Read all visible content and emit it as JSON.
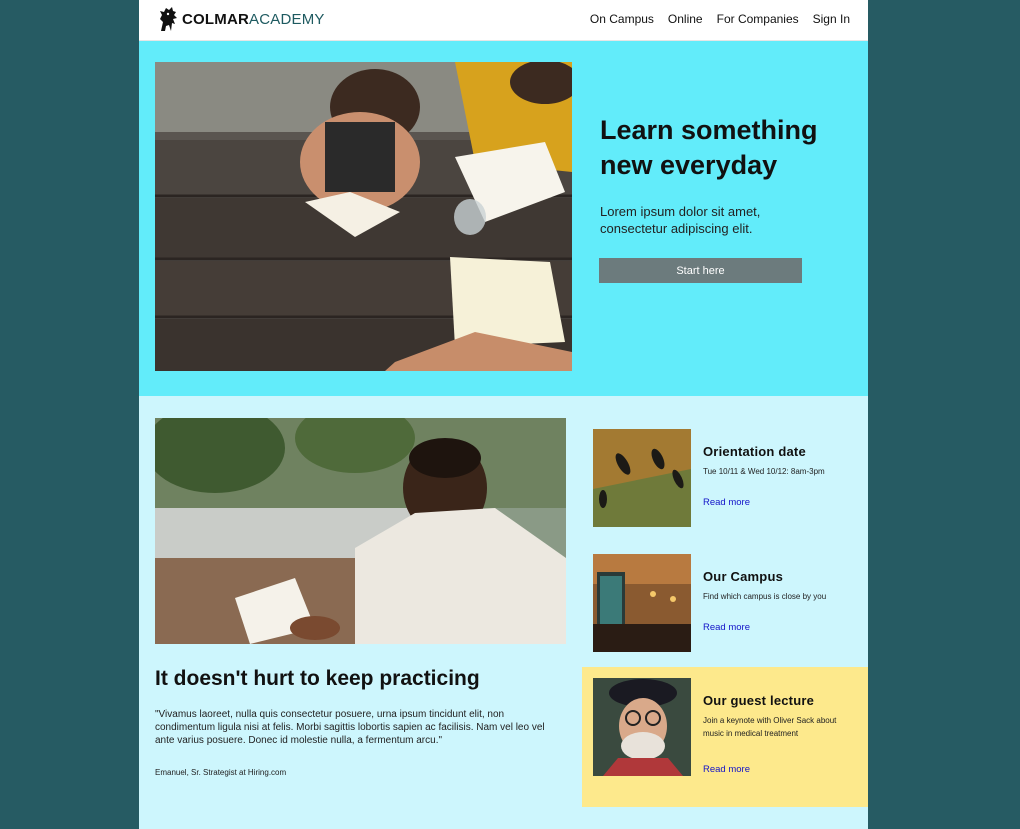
{
  "header": {
    "logo_bold": "COLMAR",
    "logo_light": "ACADEMY",
    "nav": [
      "On Campus",
      "Online",
      "For Companies",
      "Sign In"
    ]
  },
  "hero": {
    "title": "Learn something new everyday",
    "subtitle": "Lorem ipsum dolor sit amet, consectetur adipiscing elit.",
    "button": "Start here"
  },
  "main": {
    "title": "It doesn't hurt to keep practicing",
    "quote": "\"Vivamus laoreet, nulla quis consectetur posuere, urna ipsum tincidunt elit, non condimentum ligula nisi at felis. Morbi sagittis lobortis sapien ac facilisis. Nam vel leo vel ante varius posuere. Donec id molestie nulla, a fermentum arcu.\"",
    "author": "Emanuel, Sr. Strategist at Hiring.com"
  },
  "cards": [
    {
      "title": "Orientation date",
      "desc": "Tue 10/11 & Wed 10/12: 8am-3pm",
      "link": "Read more"
    },
    {
      "title": "Our Campus",
      "desc": "Find which campus is close by you",
      "link": "Read more"
    },
    {
      "title": "Our guest lecture",
      "desc": "Join a keynote with Oliver Sack about music in medical treatment",
      "link": "Read more"
    }
  ],
  "colors": {
    "background": "#265b63",
    "hero": "#62ecfa",
    "section": "#cdf6fd",
    "highlight": "#fde98c",
    "button": "#6c7b7d",
    "link": "#1414c8"
  }
}
